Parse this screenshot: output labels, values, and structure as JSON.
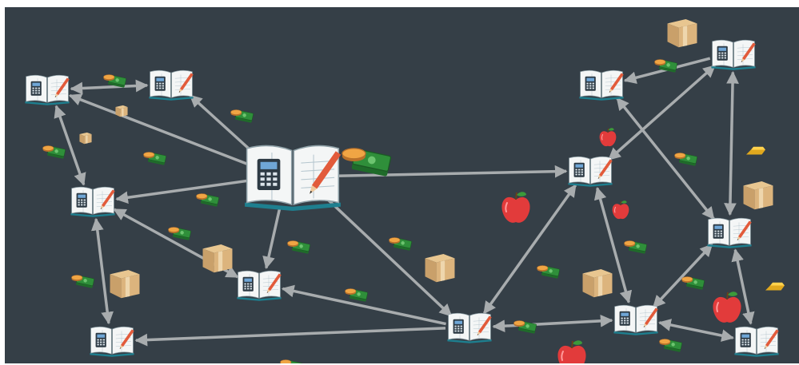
{
  "board": {
    "background": "#353f47",
    "edge_color": "#a8acae",
    "hub": {
      "icon": "ledger-book-calculator-icon",
      "id": "hub"
    },
    "nodes": [
      {
        "id": "n-topleft",
        "icon": "ledger-book-icon"
      },
      {
        "id": "n-topmid",
        "icon": "ledger-book-icon"
      },
      {
        "id": "n-left",
        "icon": "ledger-book-icon"
      },
      {
        "id": "n-midleft",
        "icon": "ledger-book-icon"
      },
      {
        "id": "n-bottomleft",
        "icon": "ledger-book-icon"
      },
      {
        "id": "n-bottommid",
        "icon": "ledger-book-icon"
      },
      {
        "id": "n-center-right",
        "icon": "ledger-book-icon"
      },
      {
        "id": "n-right-top",
        "icon": "ledger-book-icon"
      },
      {
        "id": "n-far-right-top",
        "icon": "ledger-book-icon"
      },
      {
        "id": "n-far-right-mid",
        "icon": "ledger-book-icon"
      },
      {
        "id": "n-right-bottom",
        "icon": "ledger-book-icon"
      },
      {
        "id": "n-far-right-bottom",
        "icon": "ledger-book-icon"
      }
    ],
    "edges": [
      {
        "from": "hub",
        "to": "n-topleft"
      },
      {
        "from": "hub",
        "to": "n-topmid"
      },
      {
        "from": "hub",
        "to": "n-left"
      },
      {
        "from": "hub",
        "to": "n-midleft"
      },
      {
        "from": "hub",
        "to": "n-center-right"
      },
      {
        "from": "hub",
        "to": "n-bottommid"
      },
      {
        "from": "n-topleft",
        "to": "n-topmid",
        "both": true
      },
      {
        "from": "n-topleft",
        "to": "n-left",
        "both": true
      },
      {
        "from": "n-left",
        "to": "n-midleft",
        "both": true
      },
      {
        "from": "n-left",
        "to": "n-bottomleft",
        "both": true
      },
      {
        "from": "n-midleft",
        "to": "n-bottommid",
        "reverse": true
      },
      {
        "from": "n-bottommid",
        "to": "n-bottomleft"
      },
      {
        "from": "n-bottommid",
        "to": "n-center-right",
        "both": true
      },
      {
        "from": "n-bottommid",
        "to": "n-right-bottom",
        "both": true
      },
      {
        "from": "n-far-right-top",
        "to": "n-right-top"
      },
      {
        "from": "n-far-right-top",
        "to": "n-center-right",
        "both": true
      },
      {
        "from": "n-far-right-top",
        "to": "n-far-right-mid",
        "both": true
      },
      {
        "from": "n-right-top",
        "to": "n-far-right-mid",
        "both": true
      },
      {
        "from": "n-center-right",
        "to": "n-right-bottom",
        "both": true
      },
      {
        "from": "n-far-right-mid",
        "to": "n-right-bottom",
        "both": true
      },
      {
        "from": "n-far-right-mid",
        "to": "n-far-right-bottom",
        "both": true
      },
      {
        "from": "n-right-bottom",
        "to": "n-far-right-bottom",
        "both": true
      }
    ],
    "pickups": [
      {
        "type": "cash-coins-icon"
      },
      {
        "type": "cash-coins-icon"
      },
      {
        "type": "cash-coins-icon"
      },
      {
        "type": "cash-coins-icon"
      },
      {
        "type": "cash-coins-icon"
      },
      {
        "type": "cash-coins-icon"
      },
      {
        "type": "cash-coins-icon"
      },
      {
        "type": "cash-coins-icon"
      },
      {
        "type": "cash-coins-icon"
      },
      {
        "type": "cash-coins-icon"
      },
      {
        "type": "cash-coins-icon"
      },
      {
        "type": "cash-coins-icon"
      },
      {
        "type": "cash-coins-icon"
      },
      {
        "type": "cash-coins-icon"
      },
      {
        "type": "cash-coins-icon"
      },
      {
        "type": "cash-coins-icon"
      },
      {
        "type": "cash-coins-icon"
      },
      {
        "type": "cash-coins-icon"
      },
      {
        "type": "gold-bar-icon"
      },
      {
        "type": "gold-bar-icon"
      },
      {
        "type": "cardboard-box-icon"
      },
      {
        "type": "cardboard-box-icon"
      },
      {
        "type": "cardboard-box-icon"
      },
      {
        "type": "cardboard-box-icon"
      },
      {
        "type": "cardboard-box-icon"
      },
      {
        "type": "cardboard-box-icon"
      },
      {
        "type": "cardboard-box-icon"
      },
      {
        "type": "cardboard-box-icon"
      },
      {
        "type": "red-apple-icon"
      },
      {
        "type": "red-apple-icon"
      },
      {
        "type": "red-apple-icon"
      },
      {
        "type": "red-apple-icon"
      },
      {
        "type": "red-apple-icon"
      }
    ]
  }
}
